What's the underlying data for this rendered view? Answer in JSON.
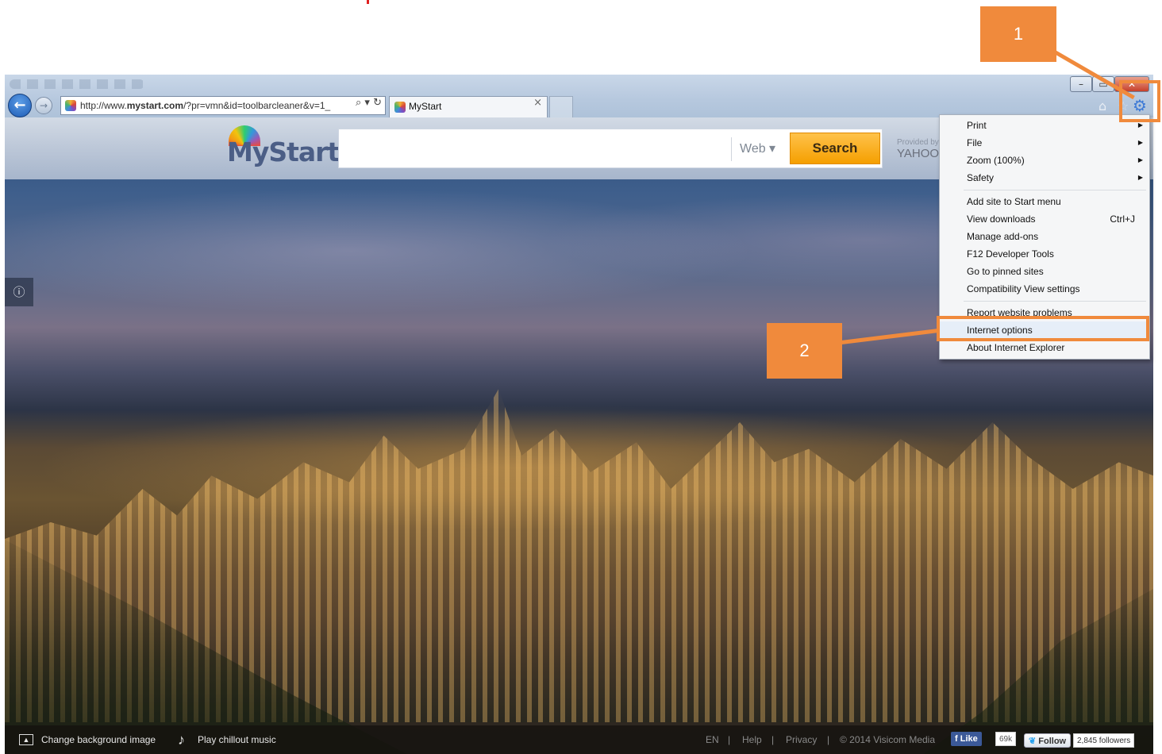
{
  "browser": {
    "address_prefix": "http://www.",
    "address_domain": "mystart.com",
    "address_rest": "/?pr=vmn&id=toolbarcleaner&v=1_",
    "tab_title": "MyStart"
  },
  "page": {
    "logo": "MyStart",
    "search_placeholder": "",
    "search_scope": "Web ▾",
    "search_button": "Search",
    "provided_by": "Provided by",
    "provider": "YAHOO"
  },
  "bottom_bar": {
    "change_background": "Change background image",
    "play_music": "Play chillout music",
    "lang": "EN",
    "help": "Help",
    "privacy": "Privacy",
    "copyright": "© 2014 Visicom Media",
    "like": "Like",
    "like_count": "69k",
    "follow": "Follow",
    "followers": "2,845 followers"
  },
  "tools_menu": {
    "items": [
      {
        "label": "Print",
        "submenu": true
      },
      {
        "label": "File",
        "submenu": true
      },
      {
        "label": "Zoom (100%)",
        "submenu": true
      },
      {
        "label": "Safety",
        "submenu": true
      },
      {
        "label": "Add site to Start menu"
      },
      {
        "label": "View downloads",
        "shortcut": "Ctrl+J"
      },
      {
        "label": "Manage add-ons"
      },
      {
        "label": "F12 Developer Tools"
      },
      {
        "label": "Go to pinned sites"
      },
      {
        "label": "Compatibility View settings"
      },
      {
        "label": "Report website problems"
      },
      {
        "label": "Internet options"
      },
      {
        "label": "About Internet Explorer"
      }
    ]
  },
  "annotations": {
    "step1": "1",
    "step2": "2",
    "color": "#f08a3c"
  },
  "icons": [
    "back-icon",
    "forward-icon",
    "search-icon",
    "refresh-icon",
    "home-icon",
    "star-icon",
    "gear-icon",
    "info-icon",
    "image-icon",
    "music-note-icon"
  ]
}
